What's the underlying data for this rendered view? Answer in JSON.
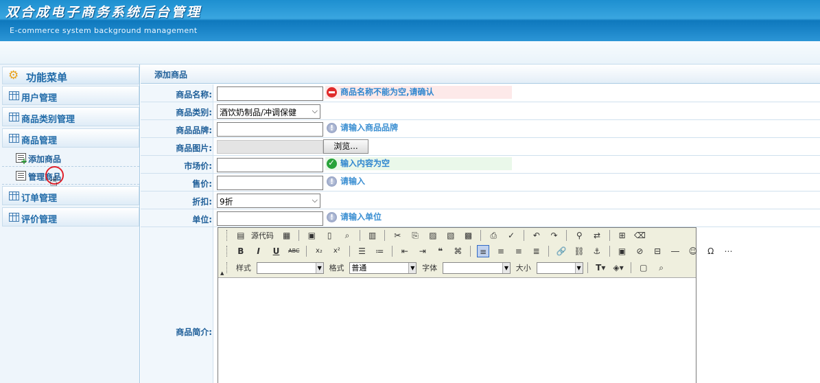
{
  "header": {
    "title": "双合成电子商务系统后台管理",
    "subtitle": "E-commerce system background management"
  },
  "sidebar": {
    "title": "功能菜单",
    "items": [
      {
        "label": "用户管理"
      },
      {
        "label": "商品类别管理"
      },
      {
        "label": "商品管理"
      },
      {
        "label": "订单管理"
      },
      {
        "label": "评价管理"
      }
    ],
    "sub_items": [
      {
        "label": "添加商品"
      },
      {
        "label": "管理商品"
      }
    ]
  },
  "main": {
    "section_title": "添加商品",
    "fields": {
      "name": {
        "label": "商品名称:",
        "value": "",
        "hint": "商品名称不能为空,请确认"
      },
      "category": {
        "label": "商品类别:",
        "selected": "酒饮奶制品/冲调保健"
      },
      "brand": {
        "label": "商品品牌:",
        "value": "",
        "hint": "请输入商品品牌"
      },
      "image": {
        "label": "商品图片:",
        "button": "浏览..."
      },
      "market_price": {
        "label": "市场价:",
        "value": "",
        "hint": "输入内容为空"
      },
      "price": {
        "label": "售价:",
        "value": "",
        "hint": "请输入"
      },
      "discount": {
        "label": "折扣:",
        "selected": "9折"
      },
      "unit": {
        "label": "单位:",
        "value": "",
        "hint": "请输入单位"
      },
      "intro": {
        "label": "商品简介:"
      }
    },
    "editor": {
      "source_label": "源代码",
      "style_label": "样式",
      "style_value": "",
      "format_label": "格式",
      "format_value": "普通",
      "font_label": "字体",
      "font_value": "",
      "size_label": "大小",
      "size_value": ""
    }
  }
}
